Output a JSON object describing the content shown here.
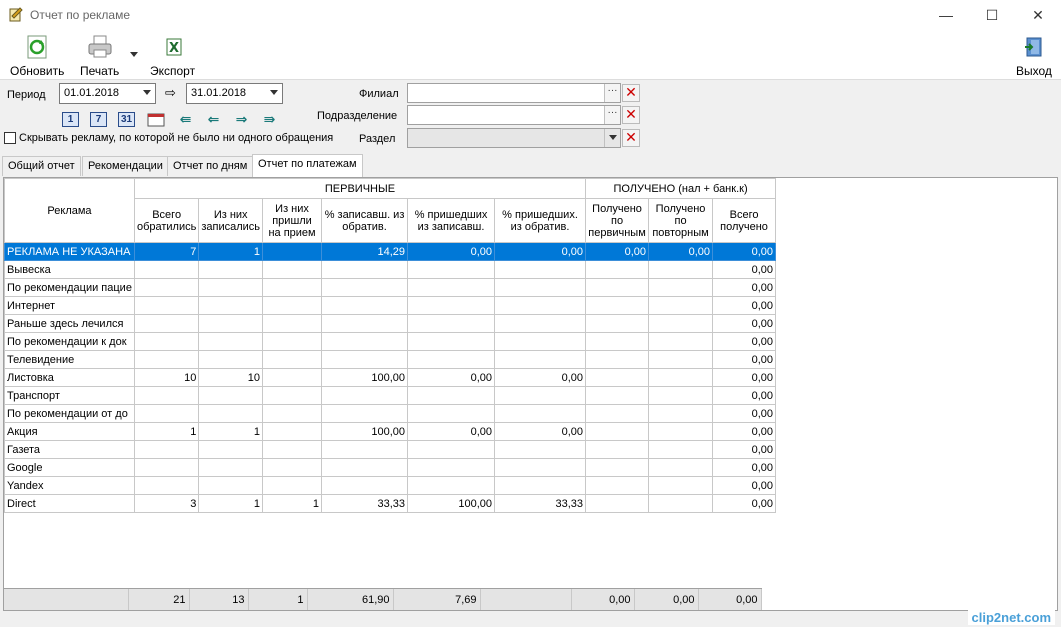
{
  "window": {
    "title": "Отчет по рекламе"
  },
  "toolbar": {
    "refresh": "Обновить",
    "print": "Печать",
    "export": "Экспорт",
    "exit": "Выход"
  },
  "filters": {
    "period_label": "Период",
    "date_from": "01.01.2018",
    "date_to": "31.01.2018",
    "branch_label": "Филиал",
    "branch_value": "",
    "department_label": "Подразделение",
    "department_value": "",
    "section_label": "Раздел",
    "section_value": "",
    "hide_checkbox_label": "Скрывать рекламу, по которой не было ни одного обращения",
    "hide_checked": false,
    "quick_buttons": [
      "1",
      "7",
      "31"
    ]
  },
  "tabs": [
    {
      "label": "Общий отчет",
      "active": false
    },
    {
      "label": "Рекомендации",
      "active": false
    },
    {
      "label": "Отчет по дням",
      "active": false
    },
    {
      "label": "Отчет по платежам",
      "active": true
    }
  ],
  "grid": {
    "group_headers": {
      "primary": "ПЕРВИЧНЫЕ",
      "received": "ПОЛУЧЕНО (нал + банк.к)"
    },
    "columns": [
      "Реклама",
      "Всего обратились",
      "Из них записались",
      "Из них пришли на прием",
      "% записавш. из обратив.",
      "% пришедших из записавш.",
      "% пришедших. из обратив.",
      "Получено по первичным",
      "Получено по повторным",
      "Всего получено"
    ],
    "rows": [
      {
        "name": "РЕКЛАМА НЕ УКАЗАНА",
        "cells": [
          "7",
          "1",
          "",
          "14,29",
          "0,00",
          "0,00",
          "0,00",
          "0,00",
          "0,00"
        ],
        "selected": true
      },
      {
        "name": "Вывеска",
        "cells": [
          "",
          "",
          "",
          "",
          "",
          "",
          "",
          "",
          "0,00"
        ]
      },
      {
        "name": "По рекомендации пацие",
        "cells": [
          "",
          "",
          "",
          "",
          "",
          "",
          "",
          "",
          "0,00"
        ]
      },
      {
        "name": "Интернет",
        "cells": [
          "",
          "",
          "",
          "",
          "",
          "",
          "",
          "",
          "0,00"
        ]
      },
      {
        "name": "Раньше здесь лечился",
        "cells": [
          "",
          "",
          "",
          "",
          "",
          "",
          "",
          "",
          "0,00"
        ]
      },
      {
        "name": "По рекомендации к док",
        "cells": [
          "",
          "",
          "",
          "",
          "",
          "",
          "",
          "",
          "0,00"
        ]
      },
      {
        "name": "Телевидение",
        "cells": [
          "",
          "",
          "",
          "",
          "",
          "",
          "",
          "",
          "0,00"
        ]
      },
      {
        "name": "Листовка",
        "cells": [
          "10",
          "10",
          "",
          "100,00",
          "0,00",
          "0,00",
          "",
          "",
          "0,00"
        ]
      },
      {
        "name": "Транспорт",
        "cells": [
          "",
          "",
          "",
          "",
          "",
          "",
          "",
          "",
          "0,00"
        ]
      },
      {
        "name": "По рекомендации от до",
        "cells": [
          "",
          "",
          "",
          "",
          "",
          "",
          "",
          "",
          "0,00"
        ]
      },
      {
        "name": "Акция",
        "cells": [
          "1",
          "1",
          "",
          "100,00",
          "0,00",
          "0,00",
          "",
          "",
          "0,00"
        ]
      },
      {
        "name": "Газета",
        "cells": [
          "",
          "",
          "",
          "",
          "",
          "",
          "",
          "",
          "0,00"
        ]
      },
      {
        "name": "Google",
        "cells": [
          "",
          "",
          "",
          "",
          "",
          "",
          "",
          "",
          "0,00"
        ]
      },
      {
        "name": "Yandex",
        "cells": [
          "",
          "",
          "",
          "",
          "",
          "",
          "",
          "",
          "0,00"
        ]
      },
      {
        "name": "Direct",
        "cells": [
          "3",
          "1",
          "1",
          "33,33",
          "100,00",
          "33,33",
          "",
          "",
          "0,00"
        ]
      }
    ],
    "totals": [
      "",
      "21",
      "13",
      "1",
      "61,90",
      "7,69",
      "",
      "0,00",
      "0,00",
      "0,00"
    ]
  },
  "watermark": "clip2net.com",
  "colors": {
    "selection": "#0078d7",
    "close_x": "#cc0000"
  }
}
